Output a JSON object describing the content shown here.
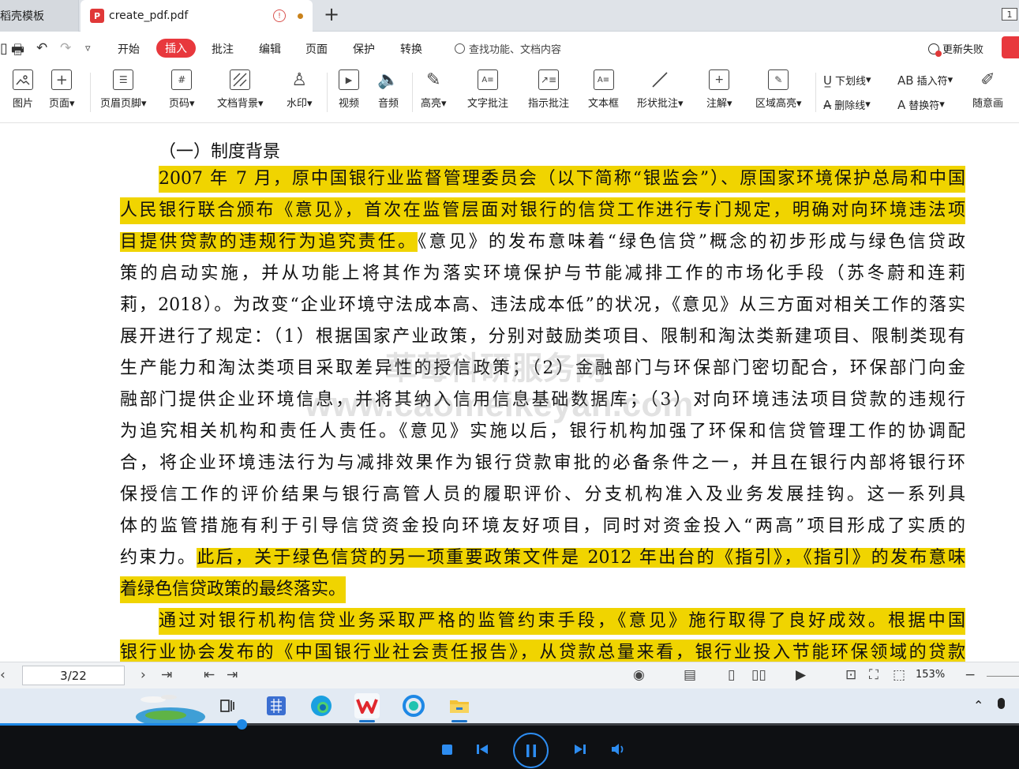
{
  "tabs": {
    "inactive_label": "稻壳模板",
    "active_label": "create_pdf.pdf",
    "pdf_icon": "P",
    "warn_icon": "!",
    "new_tab": "+",
    "page_badge": "1"
  },
  "menu": {
    "items": [
      "开始",
      "插入",
      "批注",
      "编辑",
      "页面",
      "保护",
      "转换"
    ],
    "active": "插入",
    "search_placeholder": "查找功能、文档内容",
    "sync_label": "更新失败"
  },
  "ribbon": {
    "picture": "图片",
    "page": "页面",
    "header_footer": "页眉页脚",
    "page_number": "页码",
    "doc_background": "文档背景",
    "watermark": "水印",
    "video": "视频",
    "audio": "音频",
    "highlight": "高亮",
    "text_note": "文字批注",
    "pointer_note": "指示批注",
    "textbox": "文本框",
    "shape_note": "形状批注",
    "annotation": "注解",
    "area_highlight": "区域高亮",
    "underline": "下划线",
    "strikethrough": "删除线",
    "insert_char": "插入符",
    "replace_char": "替换符",
    "freehand": "随意画"
  },
  "document": {
    "heading": "（一）制度背景",
    "lines": [
      "2007 年 7 月，原中国银行业监督管理委员会（以下简称“银监会”）、原国家环境保护总局和中国",
      "人民银行联合颁布《意见》，首次在监管层面对银行的信贷工作进行专门规定，明确对向环境违法项",
      [
        "目提供贷款的违规行为追究责任。",
        "《意见》的发布意味着“绿色信贷”概念的初步形成与绿色信贷政"
      ],
      "策的启动实施，并从功能上将其作为落实环境保护与节能减排工作的市场化手段（苏冬蔚和连莉",
      "莉，2018）。为改变“企业环境守法成本高、违法成本低”的状况，《意见》从三方面对相关工作的落实",
      "展开进行了规定：（1）根据国家产业政策，分别对鼓励类项目、限制和淘汰类新建项目、限制类现有",
      "生产能力和淘汰类项目采取差异性的授信政策；（2）金融部门与环保部门密切配合，环保部门向金",
      "融部门提供企业环境信息，并将其纳入信用信息基础数据库；（3）对向环境违法项目贷款的违规行",
      "为追究相关机构和责任人责任。《意见》实施以后，银行机构加强了环保和信贷管理工作的协调配",
      "合，将企业环境违法行为与减排效果作为银行贷款审批的必备条件之一，并且在银行内部将银行环",
      "保授信工作的评价结果与银行高管人员的履职评价、分支机构准入及业务发展挂钩。这一系列具",
      "体的监管措施有利于引导信贷资金投向环境友好项目，同时对资金投入“两高”项目形成了实质的",
      [
        "约束力。",
        "此后，关于绿色信贷的另一项重要政策文件是 2012 年出台的《指引》，《指引》的发布意味"
      ],
      "着绿色信贷政策的最终落实。",
      "通过对银行机构信贷业务采取严格的监管约束手段，《意见》施行取得了良好成效。根据中国",
      "银行业协会发布的《中国银行业社会责任报告》，从贷款总量来看，银行业投入节能环保领域的贷款"
    ],
    "watermark_cn": "草莓科研服务网",
    "watermark_en": "www.caomeikeyan.com",
    "highlight_color": "#f0d400"
  },
  "statusbar": {
    "page": "3/22",
    "zoom": "153%"
  },
  "player": {
    "progress": 0.237,
    "accent_color": "#1e88e5"
  }
}
